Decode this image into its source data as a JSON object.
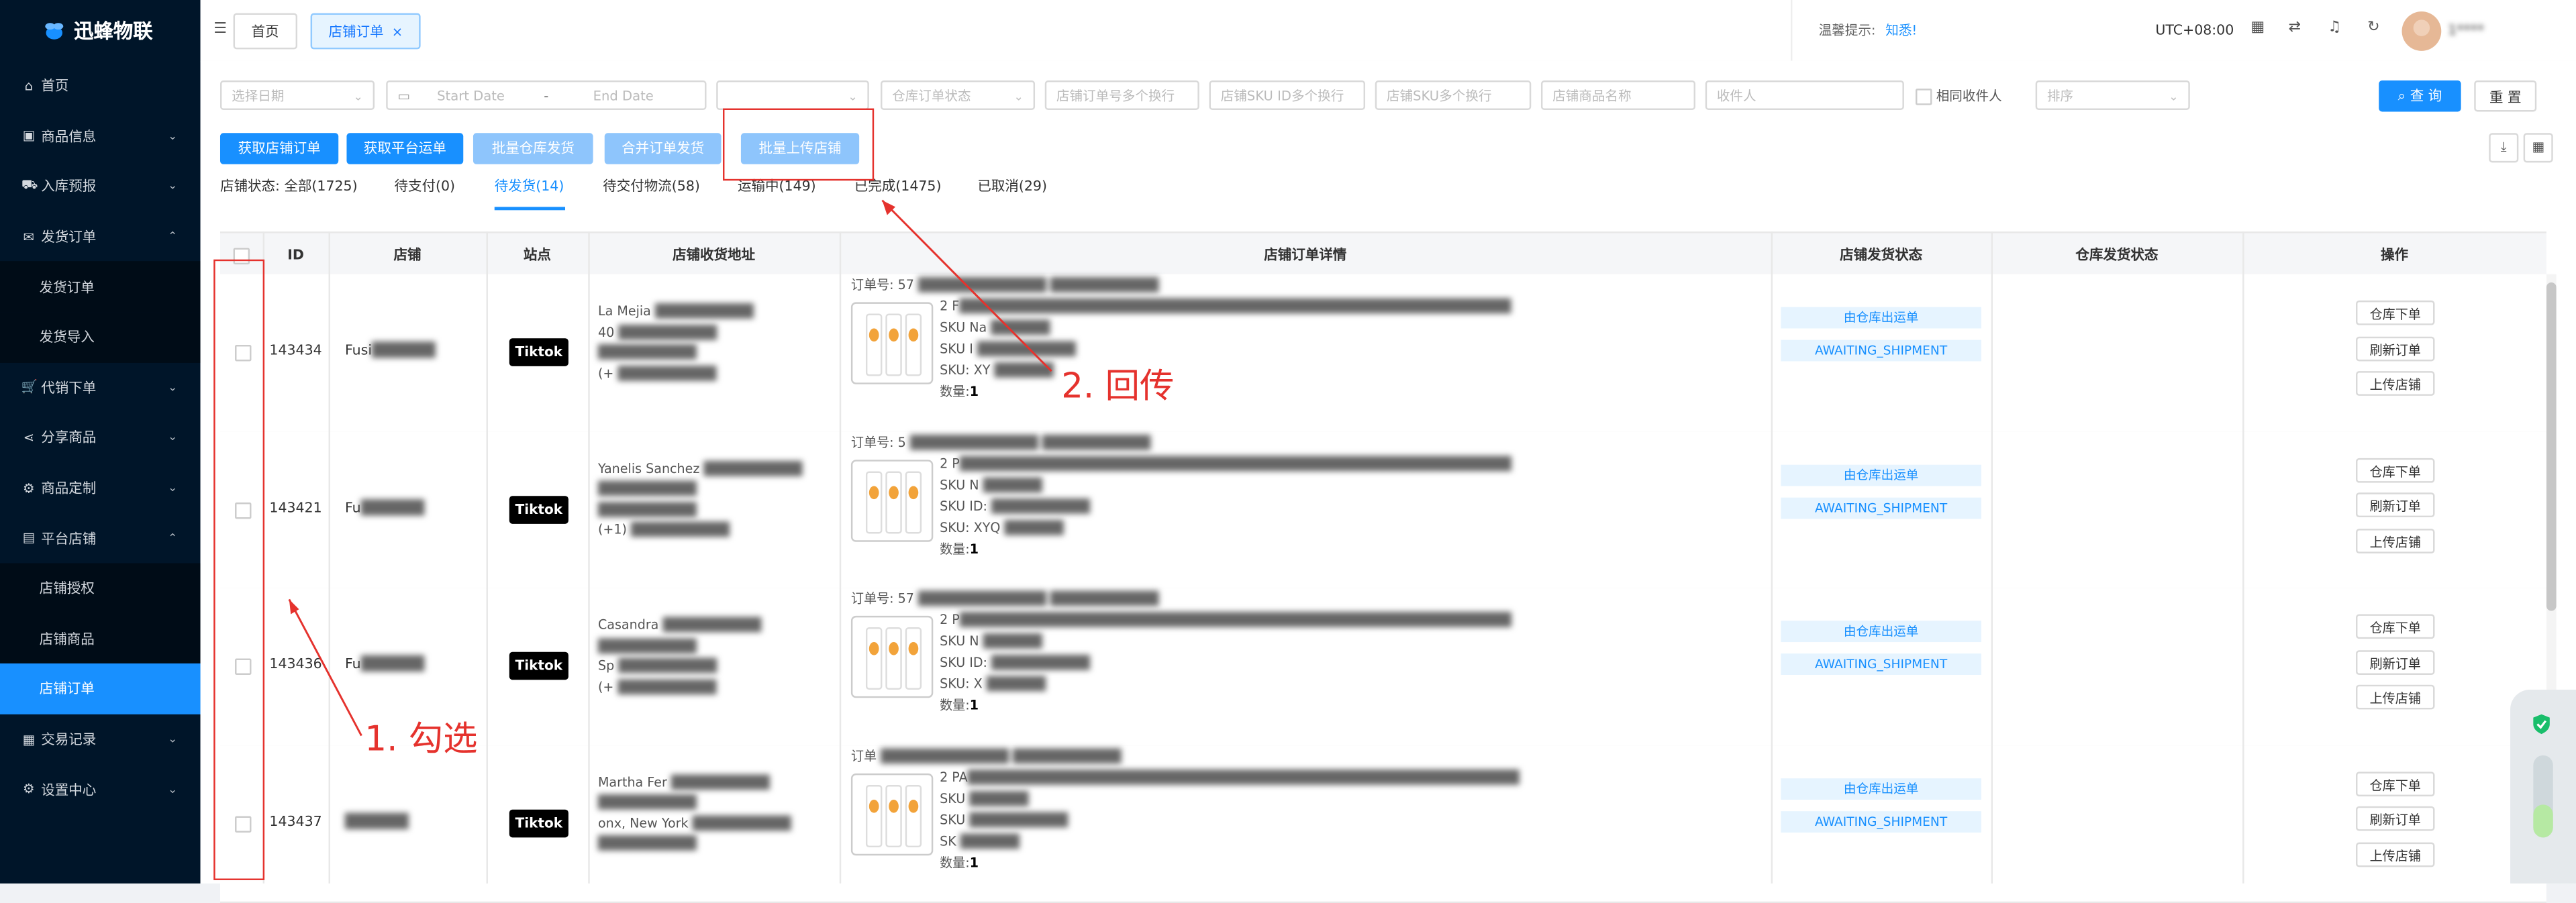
{
  "app": {
    "logo_text": "迅蜂物联"
  },
  "sidebar": {
    "items": [
      {
        "label": "首页",
        "icon": "home-icon",
        "glyph": "⌂",
        "arrow": ""
      },
      {
        "label": "商品信息",
        "icon": "gift-icon",
        "glyph": "▣",
        "arrow": "⌄"
      },
      {
        "label": "入库预报",
        "icon": "truck-icon",
        "glyph": "⛟",
        "arrow": "⌄"
      },
      {
        "label": "发货订单",
        "icon": "mail-icon",
        "glyph": "✉",
        "arrow": "⌃"
      },
      {
        "label": "发货订单",
        "icon": "",
        "glyph": "",
        "arrow": "",
        "sub": true
      },
      {
        "label": "发货导入",
        "icon": "",
        "glyph": "",
        "arrow": "",
        "sub": true
      },
      {
        "label": "代销下单",
        "icon": "cart-icon",
        "glyph": "🛒",
        "arrow": "⌄"
      },
      {
        "label": "分享商品",
        "icon": "share-icon",
        "glyph": "⋖",
        "arrow": "⌄"
      },
      {
        "label": "商品定制",
        "icon": "gear-icon",
        "glyph": "⚙",
        "arrow": "⌄"
      },
      {
        "label": "平台店铺",
        "icon": "store-icon",
        "glyph": "▤",
        "arrow": "⌃"
      },
      {
        "label": "店铺授权",
        "icon": "",
        "glyph": "",
        "arrow": "",
        "sub": true
      },
      {
        "label": "店铺商品",
        "icon": "",
        "glyph": "",
        "arrow": "",
        "sub": true
      },
      {
        "label": "店铺订单",
        "icon": "",
        "glyph": "",
        "arrow": "",
        "sub": true,
        "active": true
      },
      {
        "label": "交易记录",
        "icon": "ledger-icon",
        "glyph": "▦",
        "arrow": "⌄"
      },
      {
        "label": "设置中心",
        "icon": "settings-icon",
        "glyph": "⚙",
        "arrow": "⌄"
      }
    ]
  },
  "header": {
    "tabs": [
      {
        "label": "首页"
      },
      {
        "label": "店铺订单",
        "close": "×"
      }
    ],
    "notice_label": "温馨提示:",
    "notice_link": "知悉!",
    "timezone": "UTC+08:00",
    "username": "1****"
  },
  "filters": {
    "date_select": "选择日期",
    "start_date": "Start Date",
    "range_sep": "-",
    "end_date": "End Date",
    "order_status": "仓库订单状态",
    "order_no": "店铺订单号多个换行",
    "sku_id": "店铺SKU ID多个换行",
    "sku": "店铺SKU多个换行",
    "product_name": "店铺商品名称",
    "recipient": "收件人",
    "same_recipient": "相同收件人",
    "sort": "排序",
    "query_btn": "查 询",
    "reset_btn": "重 置"
  },
  "actions": {
    "get_orders": "获取店铺订单",
    "get_waybill": "获取平台运单",
    "batch_ship": "批量仓库发货",
    "merge_ship": "合并订单发货",
    "batch_upload": "批量上传店铺"
  },
  "status_tabs": [
    {
      "label": "店铺状态: 全部(1725)"
    },
    {
      "label": "待支付(0)"
    },
    {
      "label": "待发货(14)",
      "active": true
    },
    {
      "label": "待交付物流(58)"
    },
    {
      "label": "运输中(149)"
    },
    {
      "label": "已完成(1475)"
    },
    {
      "label": "已取消(29)"
    }
  ],
  "table": {
    "columns": [
      "ID",
      "店铺",
      "站点",
      "店铺收货地址",
      "店铺订单详情",
      "店铺发货状态",
      "仓库发货状态",
      "操作"
    ],
    "rows": [
      {
        "id": "143434",
        "shop": "Fusi",
        "site": "Tiktok",
        "address": [
          "La    Mejia",
          "40",
          "",
          "(+"
        ],
        "order_no": "订单号: 57",
        "line2": "2 F",
        "sku_name": "SKU Na",
        "sku_id": "SKU I",
        "sku": "SKU: XY",
        "qty_label": "数量:",
        "qty": "1",
        "ship_status1": "由仓库出运单",
        "ship_status2": "AWAITING_SHIPMENT",
        "ops": [
          "仓库下单",
          "刷新订单",
          "上传店铺"
        ]
      },
      {
        "id": "143421",
        "shop": "Fu",
        "site": "Tiktok",
        "address": [
          "Yanelis Sanchez",
          "",
          "",
          "(+1)"
        ],
        "order_no": "订单号: 5",
        "line2": "2 P",
        "sku_name": "SKU N",
        "sku_id": "SKU ID:",
        "sku": "SKU: XYQ",
        "qty_label": "数量:",
        "qty": "1",
        "ship_status1": "由仓库出运单",
        "ship_status2": "AWAITING_SHIPMENT",
        "ops": [
          "仓库下单",
          "刷新订单",
          "上传店铺"
        ]
      },
      {
        "id": "143436",
        "shop": "Fu",
        "site": "Tiktok",
        "address": [
          "Casandra",
          "",
          "Sp",
          "(+"
        ],
        "order_no": "订单号: 57",
        "line2": "2 P",
        "sku_name": "SKU N",
        "sku_id": "SKU ID:",
        "sku": "SKU: X",
        "qty_label": "数量:",
        "qty": "1",
        "ship_status1": "由仓库出运单",
        "ship_status2": "AWAITING_SHIPMENT",
        "ops": [
          "仓库下单",
          "刷新订单",
          "上传店铺"
        ]
      },
      {
        "id": "143437",
        "shop": "",
        "site": "Tiktok",
        "address": [
          "Martha Fer",
          "",
          "onx, New York",
          ""
        ],
        "order_no": "订单",
        "line2": "2 PA",
        "sku_name": "SKU",
        "sku_id": "SKU",
        "sku": "SK",
        "qty_label": "数量:",
        "qty": "1",
        "ship_status1": "由仓库出运单",
        "ship_status2": "AWAITING_SHIPMENT",
        "ops": [
          "仓库下单",
          "刷新订单",
          "上传店铺"
        ]
      }
    ]
  },
  "annotations": {
    "step1": "1. 勾选",
    "step2": "2. 回传"
  },
  "colors": {
    "primary": "#1890ff",
    "sidebar_bg": "#001529",
    "annotation_red": "#e5322d"
  }
}
